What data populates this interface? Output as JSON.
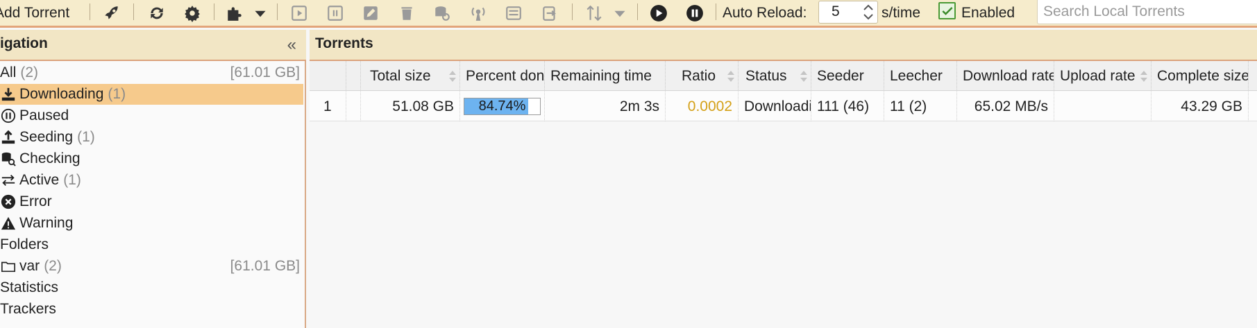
{
  "toolbar": {
    "add_torrent_label": "Add Torrent",
    "auto_reload_label": "Auto Reload:",
    "auto_reload_value": "5",
    "per_time_label": "s/time",
    "enabled_label": "Enabled",
    "search_placeholder": "Search Local Torrents",
    "icons": [
      "rocket-icon",
      "refresh-icon",
      "gear-icon",
      "plugin-icon",
      "start-icon",
      "pause-icon",
      "edit-icon",
      "delete-icon",
      "recheck-icon",
      "reannounce-icon",
      "details-icon",
      "move-icon",
      "sort-icon",
      "resume-all-icon",
      "pause-all-icon"
    ]
  },
  "navigation": {
    "title": "igation",
    "items": [
      {
        "label": "All",
        "count": "(2)",
        "size": "[61.01 GB]"
      },
      {
        "label": "Downloading",
        "count": "(1)",
        "size": ""
      },
      {
        "label": "Paused",
        "count": "",
        "size": ""
      },
      {
        "label": "Seeding",
        "count": "(1)",
        "size": ""
      },
      {
        "label": "Checking",
        "count": "",
        "size": ""
      },
      {
        "label": "Active",
        "count": "(1)",
        "size": ""
      },
      {
        "label": "Error",
        "count": "",
        "size": ""
      },
      {
        "label": "Warning",
        "count": "",
        "size": ""
      },
      {
        "label": "Folders",
        "count": "",
        "size": ""
      },
      {
        "label": "var",
        "count": "(2)",
        "size": "[61.01 GB]"
      },
      {
        "label": "Statistics",
        "count": "",
        "size": ""
      },
      {
        "label": "Trackers",
        "count": "",
        "size": ""
      }
    ]
  },
  "torrents": {
    "title": "Torrents",
    "columns": [
      "Total size",
      "Percent done",
      "Remaining time",
      "Ratio",
      "Status",
      "Seeder",
      "Leecher",
      "Download rate",
      "Upload rate",
      "Complete size"
    ],
    "rows": [
      {
        "index": "1",
        "total_size": "51.08 GB",
        "percent_done": "84.74%",
        "percent_value": 0.8474,
        "remaining_time": "2m 3s",
        "ratio": "0.0002",
        "status": "Downloading",
        "seeder": "111 (46)",
        "leecher": "11 (2)",
        "download_rate": "65.02 MB/s",
        "upload_rate": "",
        "complete_size": "43.29 GB"
      }
    ]
  },
  "colors": {
    "accent": "#f6ca8c",
    "header_bg": "#f2e6c5",
    "progress_fill": "#6db3f0",
    "ratio_text": "#d4a017"
  }
}
